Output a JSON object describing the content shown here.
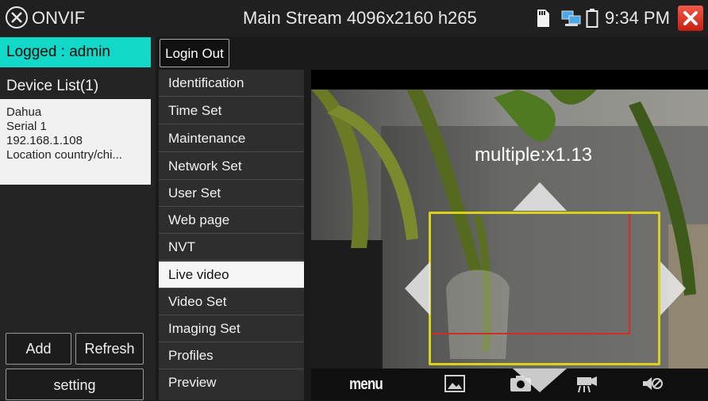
{
  "header": {
    "app_name": "ONVIF",
    "stream_title": "Main Stream 4096x2160 h265",
    "clock": "9:34 PM",
    "icons": [
      "onvif-logo-icon",
      "sd-card-icon",
      "network-icon",
      "battery-icon",
      "close-icon"
    ],
    "close_color": "#e03a2a"
  },
  "left_panel": {
    "logged": "Logged : admin",
    "device_list_header": "Device List(1)",
    "device": {
      "name": "Dahua",
      "serial": "Serial 1",
      "ip": "192.168.1.108",
      "location": "Location country/chi..."
    },
    "add_label": "Add",
    "refresh_label": "Refresh",
    "setting_label": "setting",
    "accent_color": "#12d9c7"
  },
  "menu": {
    "login_out_label": "Login Out",
    "items": [
      {
        "label": "Identification"
      },
      {
        "label": "Time Set"
      },
      {
        "label": "Maintenance"
      },
      {
        "label": "Network Set"
      },
      {
        "label": "User Set"
      },
      {
        "label": "Web page"
      },
      {
        "label": "NVT"
      },
      {
        "label": "Live video"
      },
      {
        "label": "Video Set"
      },
      {
        "label": "Imaging Set"
      },
      {
        "label": "Profiles"
      },
      {
        "label": "Preview"
      }
    ],
    "selected": "Live video"
  },
  "video": {
    "multiple_label": "multiple:x1.13",
    "zoom_box_color": "#d9d21a",
    "inner_box_color": "#d42a2a"
  },
  "toolbar": {
    "menu_label": "menu",
    "icons": [
      "image-icon",
      "camera-icon",
      "video-record-icon",
      "mute-icon"
    ]
  }
}
